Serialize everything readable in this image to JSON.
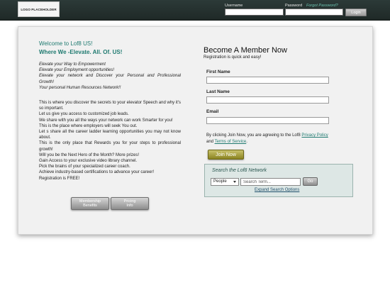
{
  "header": {
    "logo_text": "LOGO PLACEHOLDER",
    "username_label": "Username",
    "password_label": "Password",
    "forgot_password": "Forgot Password?",
    "login_button": "Login"
  },
  "intro": {
    "welcome": "Welcome to Lof8 US!",
    "tagline": "Where We -Elevate. All. Of. US!",
    "italic_lines": [
      "Elevate your Way to Empowerment",
      "Elevate your Employment opportunities!",
      "Elevate your network and Discover your Personal and Professional Growth!",
      "Your personal Human Resources Network!!"
    ],
    "body_lines": [
      "This is where you discover the secrets to your elevator Speech and why it's so important.",
      "Let us give you access to customized job leads.",
      "We share with you all the ways your network can work Smarter for you!",
      "This is the place where employers will seek You out.",
      "Let s share all the career ladder learning opportunities you may not know about.",
      "This is the only place that Rewards you for your steps to professional growth!",
      "Will you be the Next Hero of the Month? More prizes!",
      "Gain Access to your exclusive video library channel.",
      "Pick the brains of your specialized career coach.",
      "Achieve industry-based certifications to advance your career!",
      "Registration is FREE!"
    ],
    "membership_button_line1": "Membership",
    "membership_button_line2": "Benefits",
    "pricing_button_line1": "Pricing",
    "pricing_button_line2": "Info"
  },
  "register": {
    "title": "Become A Member Now",
    "subtitle": "Registration is quick and easy!",
    "first_name_label": "First Name",
    "last_name_label": "Last Name",
    "email_label": "Email",
    "agree_prefix": "By clicking Join Now, you are agreeing to the Lof8 ",
    "privacy_policy": "Privacy Policy",
    "and": " and ",
    "terms": "Terms of Service",
    "period": ".",
    "join_button": "Join Now"
  },
  "search": {
    "title": "Search the Lof8 Network",
    "category_selected": "People",
    "term_placeholder": "Search Term...",
    "go_button": "Go",
    "expand_link": "Expand Search Options"
  }
}
